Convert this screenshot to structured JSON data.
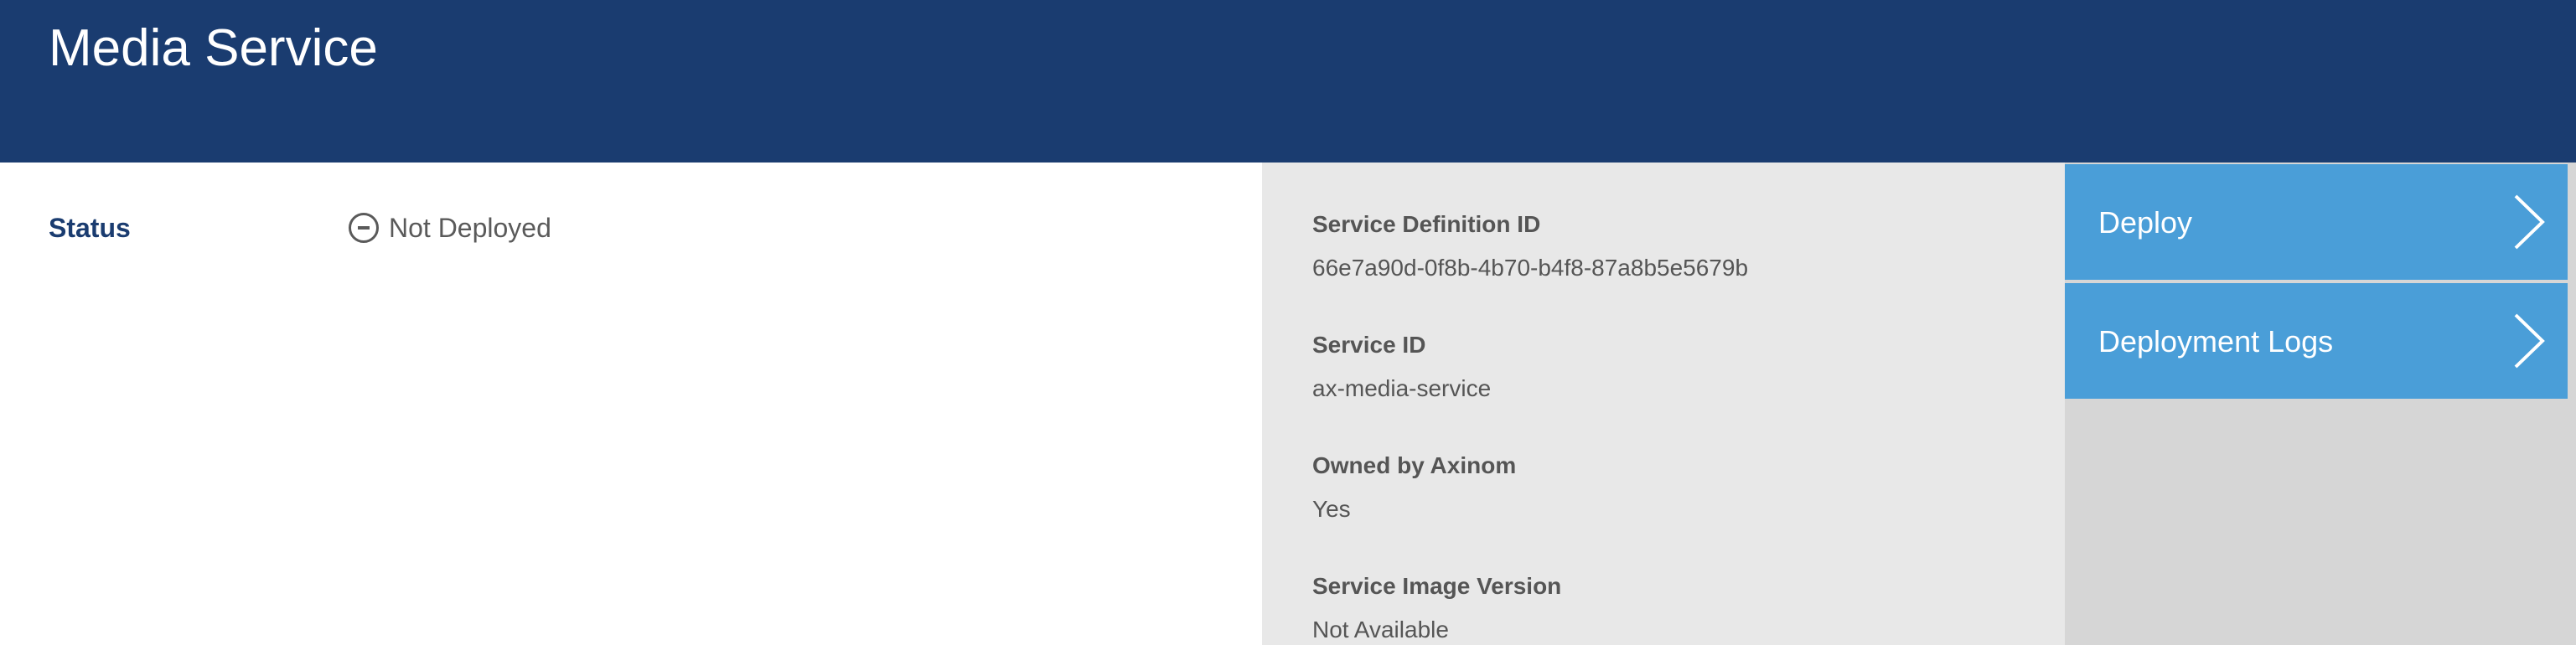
{
  "header": {
    "title": "Media Service"
  },
  "status": {
    "label": "Status",
    "value": "Not Deployed",
    "icon": "minus-circle-icon"
  },
  "details": [
    {
      "label": "Service Definition ID",
      "value": "66e7a90d-0f8b-4b70-b4f8-87a8b5e5679b"
    },
    {
      "label": "Service ID",
      "value": "ax-media-service"
    },
    {
      "label": "Owned by Axinom",
      "value": "Yes"
    },
    {
      "label": "Service Image Version",
      "value": "Not Available"
    }
  ],
  "actions": [
    {
      "label": "Deploy",
      "icon": "chevron-right-icon"
    },
    {
      "label": "Deployment Logs",
      "icon": "chevron-right-icon"
    }
  ],
  "colors": {
    "header_bg": "#1a3c70",
    "details_bg": "#e8e8e8",
    "actions_bg": "#d6d6d6",
    "action_button_bg": "#4a9ed8",
    "status_label": "#1a3c70",
    "text_gray": "#555555"
  }
}
